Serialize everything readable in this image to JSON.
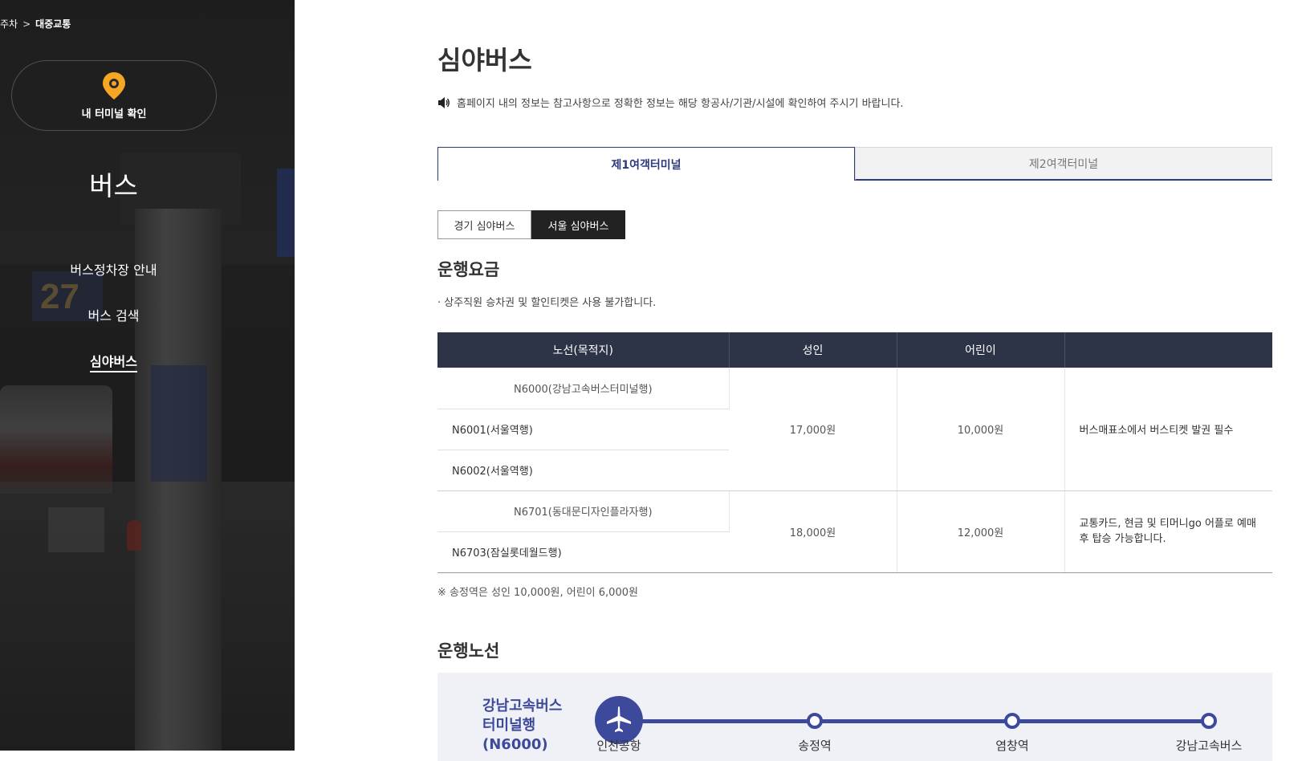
{
  "breadcrumb": {
    "prev": "주차",
    "separator": ">",
    "current": "대중교통"
  },
  "sidebar": {
    "terminal_button": "내 터미널 확인",
    "title": "버스",
    "menu": [
      {
        "label": "버스정차장 안내",
        "active": false
      },
      {
        "label": "버스 검색",
        "active": false
      },
      {
        "label": "심야버스",
        "active": true
      }
    ]
  },
  "main": {
    "page_title": "심야버스",
    "notice": "홈페이지 내의 정보는 참고사항으로 정확한 정보는 해당 항공사/기관/시설에 확인하여 주시기 바랍니다.",
    "terminal_tabs": [
      {
        "label": "제1여객터미널",
        "active": true
      },
      {
        "label": "제2여객터미널",
        "active": false
      }
    ],
    "sub_tabs": [
      {
        "label": "경기 심야버스",
        "active": false
      },
      {
        "label": "서울 심야버스",
        "active": true
      }
    ],
    "fare_section": {
      "title": "운행요금",
      "note": "· 상주직원 승차권 및 할인티켓은 사용 불가합니다.",
      "headers": [
        "노선(목적지)",
        "성인",
        "어린이",
        ""
      ],
      "groups": [
        {
          "routes": [
            "N6000(강남고속버스터미널행)",
            "N6001(서울역행)",
            "N6002(서울역행)"
          ],
          "adult": "17,000원",
          "child": "10,000원",
          "remark": "버스매표소에서 버스티켓 발권 필수"
        },
        {
          "routes": [
            "N6701(동대문디자인플라자행)",
            "N6703(잠실롯데월드행)"
          ],
          "adult": "18,000원",
          "child": "12,000원",
          "remark": "교통카드, 현금 및 티머니go 어플로 예매 후 탑승 가능합니다."
        }
      ],
      "footnote": "※ 송정역은 성인 10,000원, 어린이 6,000원"
    },
    "route_section": {
      "title": "운행노선",
      "route_name": "강남고속버스 터미널행 (N6000)",
      "route_name_lines": [
        "강남고속버스",
        "터미널행",
        "(N6000)"
      ],
      "origin_icon": "airplane-icon",
      "stations": [
        "인천공항",
        "송정역",
        "염창역",
        "강남고속버스"
      ]
    }
  },
  "colors": {
    "accent": "#2d3a7c",
    "route": "#3d4a9c",
    "table_header": "#2e3448",
    "pin": "#f5a623"
  }
}
